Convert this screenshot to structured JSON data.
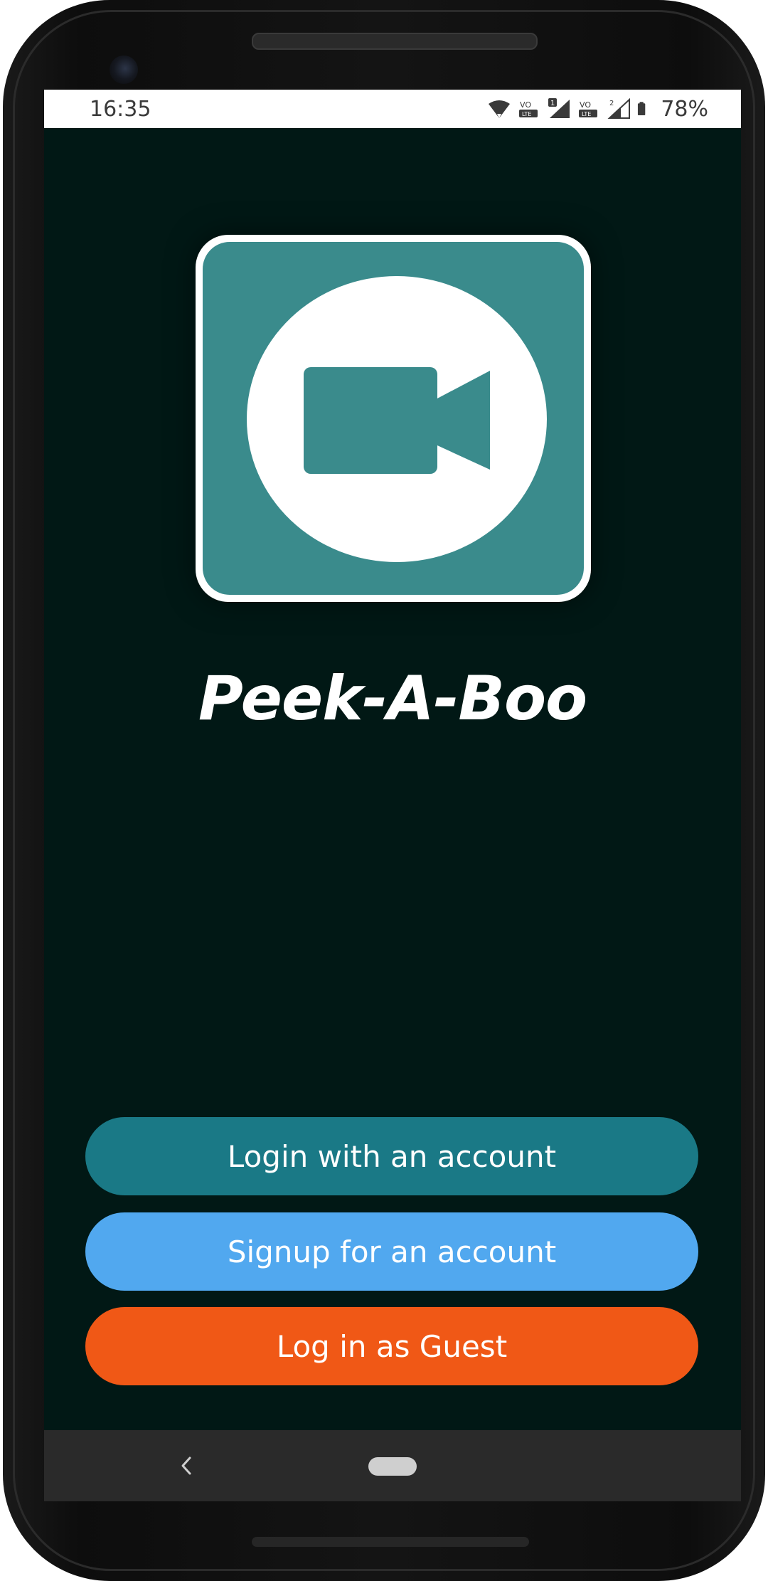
{
  "status_bar": {
    "time": "16:35",
    "battery": "78%",
    "icons": [
      "wifi-icon",
      "volte-icon",
      "sim1-signal-icon",
      "volte-icon",
      "sim2-signal-icon",
      "battery-icon"
    ],
    "sim1_label": "1",
    "sim2_label": "2"
  },
  "app": {
    "title": "Peek-A-Boo",
    "logo_icon": "video-camera-icon",
    "colors": {
      "background": "#011815",
      "logo_bg": "#3a8b8c"
    }
  },
  "buttons": {
    "login": {
      "label": "Login with an account",
      "color": "#1a7986"
    },
    "signup": {
      "label": "Signup for an account",
      "color": "#51a8ef"
    },
    "guest": {
      "label": "Log in as Guest",
      "color": "#f05816"
    }
  },
  "nav_bar": {
    "back_icon": "back-chevron-icon",
    "home_icon": "home-pill-icon"
  }
}
